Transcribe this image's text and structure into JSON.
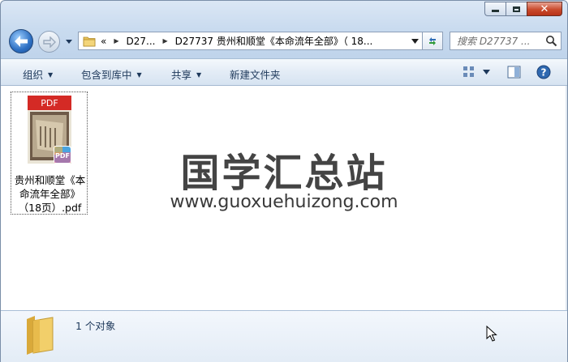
{
  "window": {
    "caption": {
      "close_symbol": "✕"
    }
  },
  "nav": {
    "address_overflow": "«",
    "breadcrumb": [
      "D27...",
      "D27737 贵州和顺堂《本命流年全部》（ 18..."
    ],
    "search_placeholder": "搜索 D27737 ..."
  },
  "toolbar": {
    "organize": "组织",
    "include_in_library": "包含到库中",
    "share": "共享",
    "new_folder": "新建文件夹"
  },
  "content": {
    "files": [
      {
        "name": "贵州和顺堂《本命流年全部》（18页）.pdf",
        "icon_label": "PDF",
        "badge_label": "PDF",
        "type": "pdf"
      }
    ],
    "watermark_title": "国学汇总站",
    "watermark_url": "www.guoxuehuizong.com"
  },
  "details": {
    "count_text": "1 个对象"
  },
  "colors": {
    "accent": "#1e395b",
    "pdf_red": "#d42a25",
    "close_red": "#c94a2c"
  },
  "icons": [
    "folder-icon",
    "back-arrow-icon",
    "forward-arrow-icon",
    "refresh-icon",
    "search-icon",
    "view-icon",
    "preview-pane-icon",
    "help-icon",
    "pdf-file-icon",
    "mouse-cursor-icon"
  ]
}
